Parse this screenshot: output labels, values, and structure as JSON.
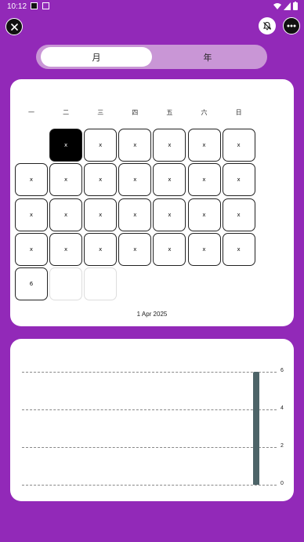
{
  "status_bar": {
    "time": "10:12"
  },
  "tabs": [
    {
      "label": "月",
      "active": true
    },
    {
      "label": "年",
      "active": false
    }
  ],
  "calendar": {
    "weekdays": [
      "一",
      "二",
      "三",
      "四",
      "五",
      "六",
      "日"
    ],
    "leading_blanks": 1,
    "days": [
      "x",
      "x",
      "x",
      "x",
      "x",
      "x",
      "x",
      "x",
      "x",
      "x",
      "x",
      "x",
      "x",
      "x",
      "x",
      "x",
      "x",
      "x",
      "x",
      "x",
      "x",
      "x",
      "x",
      "x",
      "x",
      "x",
      "x",
      "6"
    ],
    "selected_index": 0,
    "trailing_empty": 2,
    "date_label": "1  Apr  2025"
  },
  "chart_data": {
    "type": "bar",
    "categories": [
      ""
    ],
    "values": [
      6
    ],
    "yticks": [
      "6",
      "4",
      "2",
      "0"
    ],
    "ylim": [
      0,
      6
    ],
    "grid": true,
    "bar_color": "#4d6468"
  },
  "colors": {
    "background": "#9229b8",
    "segment_bg": "#c996d6"
  }
}
